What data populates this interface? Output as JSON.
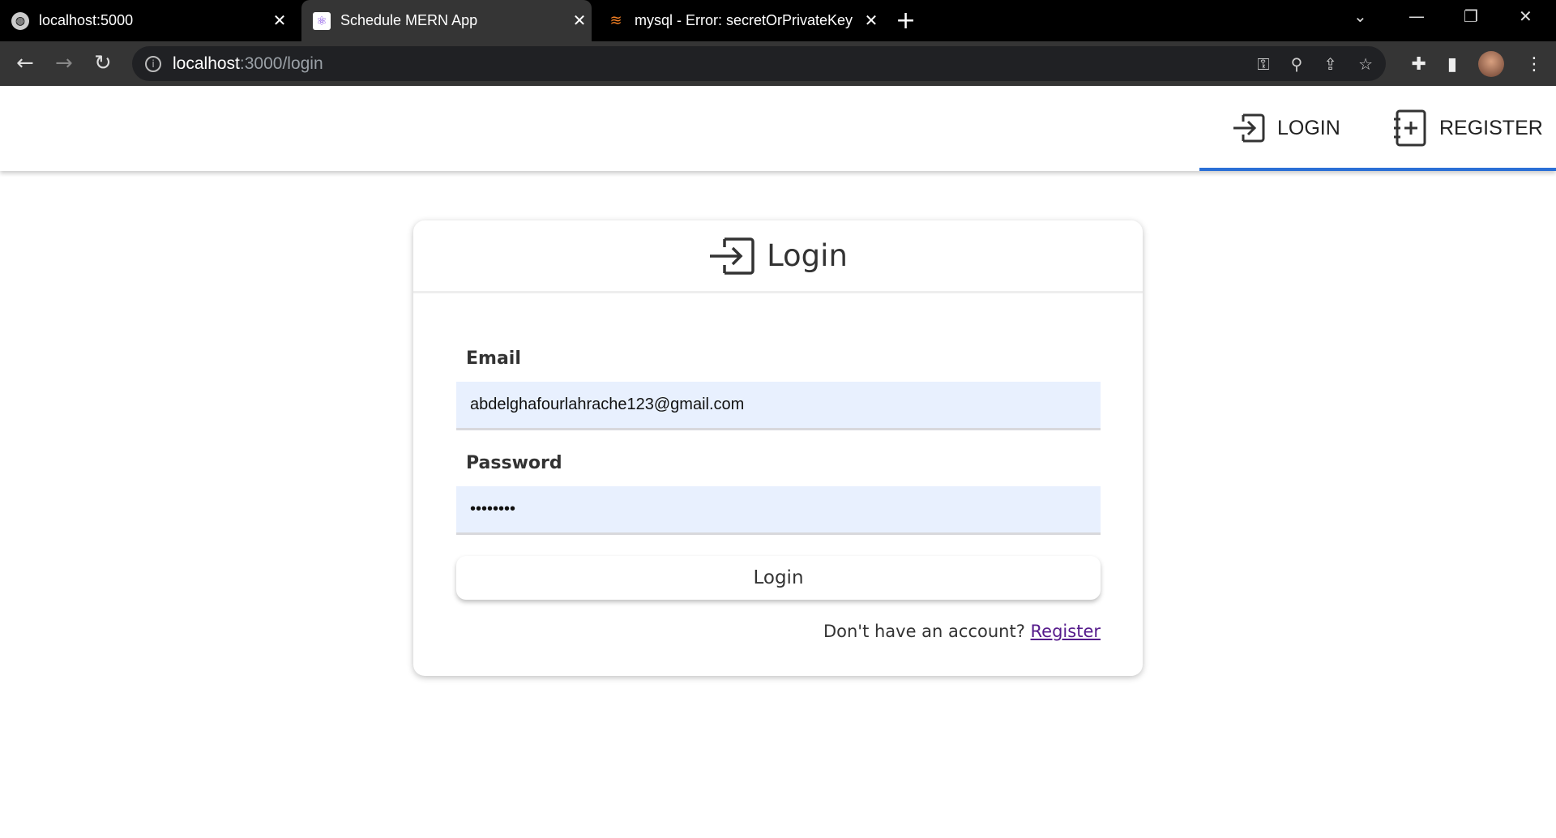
{
  "browser": {
    "tabs": [
      {
        "title": "localhost:5000",
        "icon": "globe-icon",
        "active": false
      },
      {
        "title": "Schedule MERN App",
        "icon": "react-icon",
        "active": true
      },
      {
        "title": "mysql - Error: secretOrPrivateKey",
        "icon": "stackoverflow-icon",
        "active": false
      }
    ],
    "url_host": "localhost",
    "url_rest": ":3000/login"
  },
  "navbar": {
    "login_label": "LOGIN",
    "register_label": "REGISTER",
    "active": "LOGIN",
    "accent_color": "#2a6fd6"
  },
  "card": {
    "title": "Login",
    "email_label": "Email",
    "email_value": "abdelghafourlahrache123@gmail.com",
    "password_label": "Password",
    "password_value": "password",
    "submit_label": "Login",
    "footer_text": "Don't have an account? ",
    "footer_link": "Register",
    "input_bg": "#e8f0fe"
  }
}
